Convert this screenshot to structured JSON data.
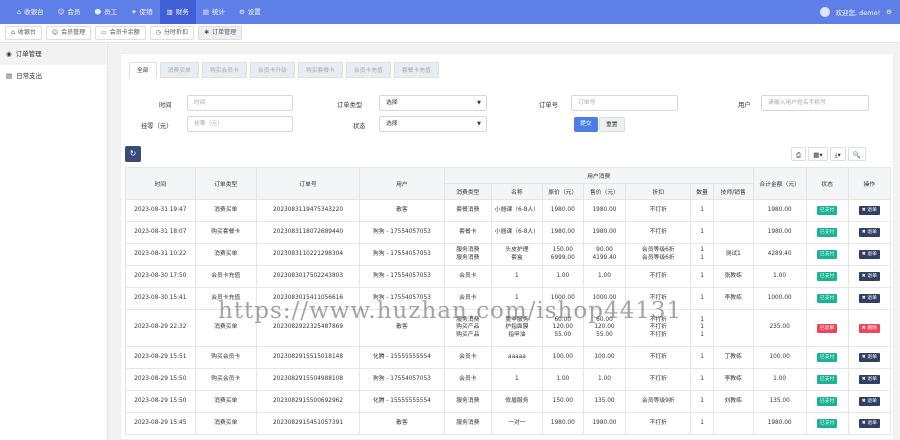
{
  "topnav": {
    "items": [
      {
        "label": "收银台",
        "icon": "cashier-icon"
      },
      {
        "label": "会员",
        "icon": "member-icon"
      },
      {
        "label": "员工",
        "icon": "staff-icon"
      },
      {
        "label": "促销",
        "icon": "promotion-icon"
      },
      {
        "label": "财务",
        "icon": "finance-icon"
      },
      {
        "label": "统计",
        "icon": "chart-icon"
      },
      {
        "label": "设置",
        "icon": "gear-icon"
      }
    ],
    "active_index": 4,
    "welcome": "欢迎您, demo!"
  },
  "tabbar": [
    {
      "label": "收银台"
    },
    {
      "label": "会员管理"
    },
    {
      "label": "会员卡余额"
    },
    {
      "label": "分时折扣"
    },
    {
      "label": "订单管理"
    }
  ],
  "sidebar": [
    {
      "label": "订单管理"
    },
    {
      "label": "日常支出"
    }
  ],
  "subtabs": [
    "全部",
    "消费买单",
    "购买会员卡",
    "会员卡升级",
    "购买套餐卡",
    "会员卡充值",
    "套餐卡充值"
  ],
  "filters": {
    "time_label": "时间",
    "time_placeholder": "时间",
    "order_type_label": "订单类型",
    "order_type_value": "选择",
    "order_no_label": "订单号",
    "order_no_placeholder": "订单号",
    "user_label": "用户",
    "user_placeholder": "请输入用户姓名手机号",
    "discount_label": "挂零（元）",
    "discount_placeholder": "挂零（元）",
    "status_label": "状态",
    "status_value": "选择",
    "submit_label": "提交",
    "reset_label": "重置"
  },
  "table": {
    "headers": {
      "time": "时间",
      "order_type": "订单类型",
      "order_no": "订单号",
      "user": "用户",
      "consumption": "用户消费",
      "consume_type": "消费类型",
      "name": "名称",
      "original_price": "原价（元）",
      "sale_price": "售价（元）",
      "discount": "折扣",
      "quantity": "数量",
      "technician": "技师/销售",
      "total": "合计金额（元）",
      "status": "状态",
      "action": "操作"
    },
    "rows": [
      {
        "time": "2023-08-31 19:47",
        "type": "消费买单",
        "no": "2023083119475343220",
        "user": "散客",
        "ctype": "套餐消费",
        "name": "小翘课（6-8人）",
        "orig": "1980.00",
        "sale": "1980.00",
        "disc": "不打折",
        "qty": "1",
        "tech": "",
        "total": "1980.00",
        "status": "已支付",
        "status_kind": "paid",
        "action": "退单",
        "action_kind": "refund"
      },
      {
        "time": "2023-08-31 18:07",
        "type": "购买套餐卡",
        "no": "2023083118072689440",
        "user": "狗狗 - 17554057053",
        "ctype": "套餐卡",
        "name": "小翘课（6-8人）",
        "orig": "1980.00",
        "sale": "1980.00",
        "disc": "不打折",
        "qty": "1",
        "tech": "",
        "total": "1980.00",
        "status": "已支付",
        "status_kind": "paid",
        "action": "退单",
        "action_kind": "refund"
      },
      {
        "time": "2023-08-31 10:22",
        "type": "消费买单",
        "no": "2023083110221298304",
        "user": "狗狗 - 17554057053",
        "ctype": "服务消费\n服务消费",
        "name": "头皮护理\n套盒",
        "orig": "150.00\n6999.00",
        "sale": "90.00\n4199.40",
        "disc": "会员等级6折\n会员等级6折",
        "qty": "1\n1",
        "tech": "测试1\n",
        "total": "4289.40",
        "status": "已支付",
        "status_kind": "paid",
        "action": "退单",
        "action_kind": "refund"
      },
      {
        "time": "2023-08-30 17:50",
        "type": "会员卡充值",
        "no": "2023083017502243803",
        "user": "狗狗 - 17554057053",
        "ctype": "会员卡",
        "name": "1",
        "orig": "1.00",
        "sale": "1.00",
        "disc": "不打折",
        "qty": "1",
        "tech": "张教练",
        "total": "1.00",
        "status": "已支付",
        "status_kind": "paid",
        "action": "退单",
        "action_kind": "refund"
      },
      {
        "time": "2023-08-30 15:41",
        "type": "会员卡充值",
        "no": "2023083015411056616",
        "user": "狗狗 - 17554057053",
        "ctype": "会员卡",
        "name": "1",
        "orig": "1000.00",
        "sale": "1000.00",
        "disc": "不打折",
        "qty": "1",
        "tech": "李教练",
        "total": "1000.00",
        "status": "已支付",
        "status_kind": "paid",
        "action": "退单",
        "action_kind": "refund"
      },
      {
        "time": "2023-08-29 22:32",
        "type": "消费买单",
        "no": "2023082922325487869",
        "user": "散客",
        "ctype": "服务消费\n购买产品\n购买产品",
        "name": "美甲服务\n护指面膜\n指甲油",
        "orig": "60.00\n120.00\n55.00",
        "sale": "60.00\n120.00\n55.00",
        "disc": "不打折\n不打折\n不打折",
        "qty": "1\n1\n1",
        "tech": "",
        "total": "235.00",
        "status": "已退单",
        "status_kind": "refunded",
        "action": "删除",
        "action_kind": "delete"
      },
      {
        "time": "2023-08-29 15:51",
        "type": "购买会员卡",
        "no": "2023082915515018148",
        "user": "化腾 - 15555555554",
        "ctype": "会员卡",
        "name": "aaaaa",
        "orig": "100.00",
        "sale": "100.00",
        "disc": "不打折",
        "qty": "1",
        "tech": "丁教练",
        "total": "100.00",
        "status": "已支付",
        "status_kind": "paid",
        "action": "退单",
        "action_kind": "refund"
      },
      {
        "time": "2023-08-29 15:50",
        "type": "购买会员卡",
        "no": "2023082915504988108",
        "user": "狗狗 - 17554057053",
        "ctype": "会员卡",
        "name": "1",
        "orig": "1.00",
        "sale": "1.00",
        "disc": "不打折",
        "qty": "1",
        "tech": "李教练",
        "total": "1.00",
        "status": "已支付",
        "status_kind": "paid",
        "action": "退单",
        "action_kind": "refund"
      },
      {
        "time": "2023-08-29 15:50",
        "type": "消费买单",
        "no": "2023082915500692962",
        "user": "化腾 - 15555555554",
        "ctype": "服务消费",
        "name": "修眉服务",
        "orig": "150.00",
        "sale": "135.00",
        "disc": "会员等级9折",
        "qty": "1",
        "tech": "刘教练",
        "total": "135.00",
        "status": "已支付",
        "status_kind": "paid",
        "action": "退单",
        "action_kind": "refund"
      },
      {
        "time": "2023-08-29 15:45",
        "type": "消费买单",
        "no": "2023082915451057391",
        "user": "散客",
        "ctype": "服务消费",
        "name": "一对一",
        "orig": "1980.00",
        "sale": "1980.00",
        "disc": "不打折",
        "qty": "1",
        "tech": "",
        "total": "1980.00",
        "status": "已支付",
        "status_kind": "paid",
        "action": "退单",
        "action_kind": "refund"
      }
    ]
  },
  "watermark": "https://www.huzhan.com/ishop44131"
}
